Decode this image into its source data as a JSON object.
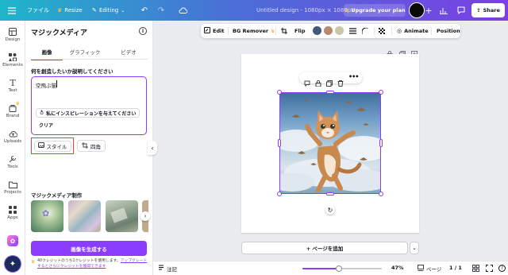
{
  "topbar": {
    "file": "ファイル",
    "resize": "Resize",
    "editing": "Editing",
    "doc_title": "Untitled design - 1080px × 1080px",
    "upgrade": "Upgrade your plan",
    "share": "Share"
  },
  "rail": {
    "items": [
      "Design",
      "Elements",
      "Text",
      "Brand",
      "Uploads",
      "Tools",
      "Projects",
      "Apps"
    ]
  },
  "panel": {
    "title": "マジックメディア",
    "tabs": [
      "画像",
      "グラフィック",
      "ビデオ"
    ],
    "prompt_label": "何を創造したいか説明してください",
    "prompt_value": "空飛ぶ猫",
    "inspire": "私にインスピレーションを与えてください",
    "clear": "クリア",
    "style_btn": "スタイル",
    "ratio_btn": "四角",
    "section_title": "マジックメディア制作",
    "generate": "画像を生成する",
    "credits_text": "40クレジットのうち1クレジットを使用します。",
    "credits_link": "アップグレードするとさらにクレジットを獲得できます"
  },
  "context_toolbar": {
    "edit": "Edit",
    "bg_remover": "BG Remover",
    "flip": "Flip",
    "animate": "Animate",
    "position": "Position",
    "swatches": [
      "#3f5a7a",
      "#b68a6f",
      "#cbc8a9"
    ]
  },
  "canvas": {
    "add_page": "+ ページを追加"
  },
  "bottombar": {
    "notes": "注記",
    "zoom": "47%",
    "pages": "ページ",
    "page_count": "1 / 1"
  },
  "colors": {
    "accent": "#8b3dff",
    "upgrade_btn": "#7d2ae8"
  }
}
